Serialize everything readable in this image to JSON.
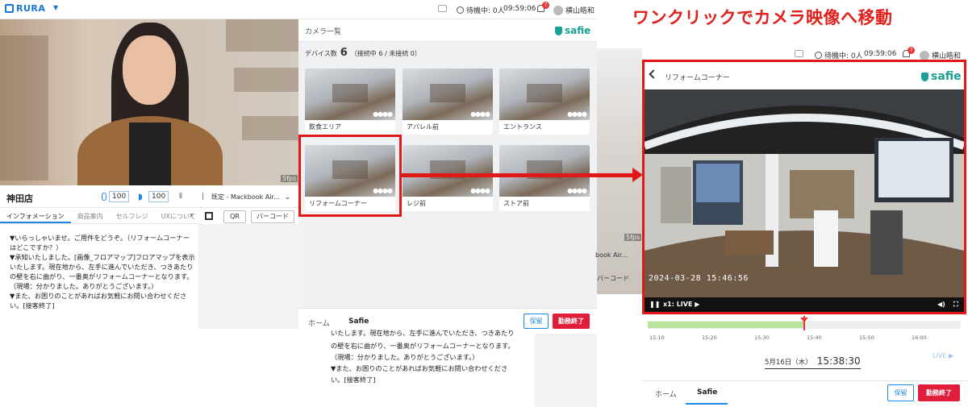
{
  "app": {
    "logo": "RURA"
  },
  "topbar": {
    "waiting": "待機中: 0人",
    "time": "09:59:06",
    "notif_count": "7",
    "user": "横山皓和"
  },
  "left_video": {
    "fps": "5fps"
  },
  "controls": {
    "store_name": "神田店",
    "mic_volume": "100",
    "speaker_volume": "100",
    "device_select": "既定 - Mackbook Air..."
  },
  "left_tabs": [
    "インフォメーション",
    "商品案内",
    "セルフレジ",
    "UXについて"
  ],
  "left_tabs_more": "›",
  "code_buttons": {
    "qr": "QR",
    "barcode": "バーコード"
  },
  "info_lines": [
    "▼いらっしゃいませ。ご用件をどうぞ。（リフォームコーナー",
    "はどこですか？）",
    "▼承知いたしました。[画像_フロアマップ]フロアマップを表示",
    "いたします。現在地から、左手に進んでいただき、つきあたり",
    "の壁を右に曲がり、一番奥がリフォームコーナーとなります。",
    "（現場：分かりました。ありがとうございます。）",
    "▼また、お困りのことがあればお気軽にお問い合わせくださ",
    "い。[接客終了]"
  ],
  "camera_panel": {
    "title": "カメラ一覧",
    "brand": "safie",
    "device_label": "デバイス数",
    "device_count": "6",
    "device_status": "（接続中 6 / 未接続 0）",
    "cameras": [
      "飲食エリア",
      "アパレル前",
      "エントランス",
      "リフォームコーナー",
      "レジ前",
      "ストア前"
    ],
    "dots": "●●●●"
  },
  "bottom_nav": {
    "home": "ホーム",
    "safie": "Safie",
    "hold": "保留",
    "end": "勤務終了"
  },
  "lower_text": [
    "いたします。現在地から、左手に進んでいただき、つきあたり",
    "の壁を右に曲がり、一番奥がリフォームコーナーとなります。",
    "（現場：分かりました。ありがとうございます。）",
    "▼また、お困りのことがあればお気軽にお問い合わせくださ",
    "い。[接客終了]"
  ],
  "headline": "ワンクリックでカメラ映像へ移動",
  "right_strip": {
    "select": "book Air...",
    "barcode": "バーコード",
    "fps": "5fps"
  },
  "camera_view": {
    "name": "リフォームコーナー",
    "brand": "safie",
    "timestamp": "2024-03-28  15:46:56",
    "speed": "x1: LIVE ▶",
    "ticks": [
      "15:10",
      "15:20",
      "15:30",
      "15:40",
      "15:50",
      "16:00"
    ],
    "live": "LIVE ▶",
    "date": "5月16日（木）",
    "time": "15:38:30",
    "progress": 0.5
  },
  "colors": {
    "accent": "#1e88e5",
    "brand": "#1aa095",
    "alert": "#e01818"
  }
}
